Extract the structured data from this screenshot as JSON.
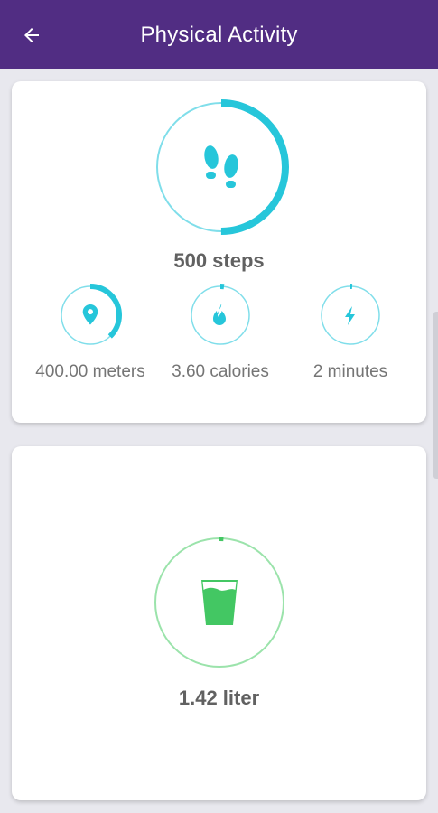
{
  "header": {
    "title": "Physical Activity",
    "back_icon": "arrow-left-icon"
  },
  "steps": {
    "value_text": "500 steps",
    "progress": 0.5,
    "icon": "footprints-icon",
    "color": "#26c6da",
    "track_color": "#80deea"
  },
  "stats": [
    {
      "icon": "location-pin-icon",
      "label": "400.00 meters",
      "progress": 0.38
    },
    {
      "icon": "fire-icon",
      "label": "3.60 calories",
      "progress": 0.02
    },
    {
      "icon": "lightning-icon",
      "label": "2 minutes",
      "progress": 0.01
    }
  ],
  "water": {
    "value_text": "1.42 liter",
    "progress": 0.01,
    "icon": "glass-of-water-icon",
    "color": "#43c763",
    "track_color": "#9be3ab"
  }
}
